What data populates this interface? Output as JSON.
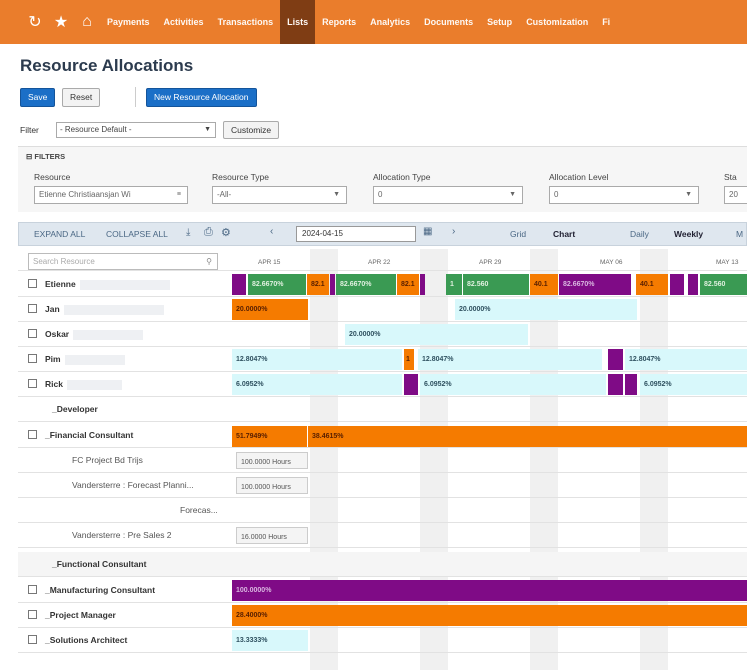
{
  "nav": {
    "icons": [
      "refresh-icon",
      "star-icon",
      "home-icon"
    ],
    "items": [
      "Payments",
      "Activities",
      "Transactions",
      "Lists",
      "Reports",
      "Analytics",
      "Documents",
      "Setup",
      "Customization",
      "Fi"
    ],
    "active_index": 3
  },
  "page": {
    "title": "Resource Allocations"
  },
  "buttons": {
    "save": "Save",
    "reset": "Reset",
    "new": "New Resource Allocation",
    "customize": "Customize"
  },
  "filter": {
    "label": "Filter",
    "value": "- Resource Default -"
  },
  "filters": {
    "header": "FILTERS",
    "resource": {
      "label": "Resource",
      "value": "Etienne Christiaansjan Wi"
    },
    "resource_type": {
      "label": "Resource Type",
      "value": "-All-"
    },
    "allocation_type": {
      "label": "Allocation Type",
      "value": "0"
    },
    "allocation_level": {
      "label": "Allocation Level",
      "value": "0"
    },
    "start": {
      "label": "Sta",
      "value": "20"
    }
  },
  "toolbar": {
    "expand_all": "EXPAND ALL",
    "collapse_all": "COLLAPSE ALL",
    "date": "2024-04-15",
    "grid": "Grid",
    "chart": "Chart",
    "daily": "Daily",
    "weekly": "Weekly",
    "more": "M"
  },
  "search": {
    "placeholder": "Search Resource"
  },
  "timeline": {
    "ticks": [
      "APR 15",
      "APR 22",
      "APR 29",
      "MAY 06",
      "MAY 13"
    ]
  },
  "rows": [
    {
      "label": "Etienne",
      "kind": "resource"
    },
    {
      "label": "Jan",
      "kind": "resource"
    },
    {
      "label": "Oskar",
      "kind": "resource"
    },
    {
      "label": "Pim",
      "kind": "resource"
    },
    {
      "label": "Rick",
      "kind": "resource"
    },
    {
      "label": "_Developer",
      "kind": "group"
    },
    {
      "label": "_Financial Consultant",
      "kind": "resource"
    },
    {
      "label": "FC Project Bd Trijs",
      "kind": "project"
    },
    {
      "label": "Vandersterre : Forecast Planni...",
      "kind": "project"
    },
    {
      "label": "Forecas...",
      "kind": "project"
    },
    {
      "label": "Vandersterre : Pre Sales 2",
      "kind": "project"
    },
    {
      "label": "_Functional Consultant",
      "kind": "group"
    },
    {
      "label": "_Manufacturing Consultant",
      "kind": "resource"
    },
    {
      "label": "_Project Manager",
      "kind": "resource"
    },
    {
      "label": "_Solutions Architect",
      "kind": "resource"
    }
  ],
  "bars": {
    "etienne": [
      "82.6670%",
      "82.1",
      "82.6670%",
      "82.1",
      "1",
      "82.560",
      "40.1",
      "82.6670%",
      "40.1",
      "82.560"
    ],
    "jan": [
      "20.0000%",
      "20.0000%"
    ],
    "oskar": [
      "20.0000%"
    ],
    "pim": [
      "12.8047%",
      "1",
      "12.8047%",
      "12.8047%"
    ],
    "rick": [
      "6.0952%",
      "6.0952%",
      "6.0952%"
    ],
    "financial": [
      "51.7949%",
      "38.4615%"
    ],
    "fc_project": "100.0000 Hours",
    "forecast": "100.0000 Hours",
    "presales": "16.0000 Hours",
    "manufacturing": "100.0000%",
    "project_manager": "28.4000%",
    "solutions_architect": "13.3333%"
  },
  "colors": {
    "nav": "#ea7d2c",
    "orange": "#f57b00",
    "purple": "#7f0b86",
    "green": "#3a9a53",
    "cyan": "#d8f8fb",
    "blue": "#1b6fc7"
  }
}
